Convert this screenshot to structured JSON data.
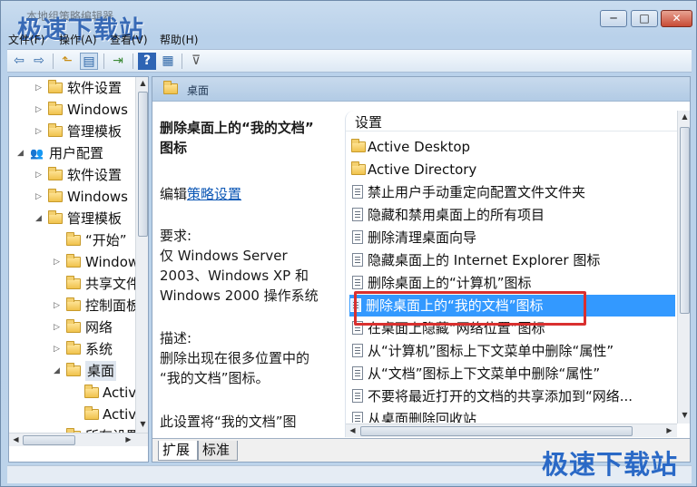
{
  "window": {
    "title": "本地组策略编辑器",
    "watermark_top": "极速下载站",
    "watermark_bottom": "极速下载站",
    "controls": {
      "minimize": "─",
      "maximize": "□",
      "close": "✕"
    }
  },
  "menu": [
    "文件(F)",
    "操作(A)",
    "查看(V)",
    "帮助(H)"
  ],
  "toolbar": {
    "icons": [
      "back-arrow-icon",
      "forward-arrow-icon",
      "up-folder-icon",
      "show-tree-icon",
      "export-list-icon",
      "help-icon",
      "properties-icon",
      "filter-icon"
    ],
    "glyphs": [
      "⇦",
      "⇨",
      "⬑",
      "▤",
      "⇥",
      "?",
      "▦",
      "⊽"
    ]
  },
  "tree": [
    {
      "label": "软件设置",
      "expander": "▷"
    },
    {
      "label": "Windows",
      "expander": "▷"
    },
    {
      "label": "管理模板",
      "expander": "▷"
    },
    {
      "label": "用户配置",
      "expander": "◢"
    },
    {
      "label": "软件设置",
      "expander": "▷"
    },
    {
      "label": "Windows",
      "expander": "▷"
    },
    {
      "label": "管理模板",
      "expander": "◢"
    },
    {
      "label": "“开始”",
      "expander": ""
    },
    {
      "label": "Window",
      "expander": "▷"
    },
    {
      "label": "共享文件",
      "expander": ""
    },
    {
      "label": "控制面板",
      "expander": "▷"
    },
    {
      "label": "网络",
      "expander": "▷"
    },
    {
      "label": "系统",
      "expander": "▷"
    },
    {
      "label": "桌面",
      "expander": "◢"
    },
    {
      "label": "Activ",
      "expander": ""
    },
    {
      "label": "Activ",
      "expander": ""
    },
    {
      "label": "所有设置",
      "expander": ""
    }
  ],
  "breadcrumb": "桌面",
  "description": {
    "title_line1": "删除桌面上的“我的文档”",
    "title_line2": "图标",
    "edit_prefix": "编辑",
    "edit_link": "策略设置",
    "req_label": "要求:",
    "req_line1": "仅 Windows Server",
    "req_line2": "2003、Windows XP 和",
    "req_line3": "Windows 2000 操作系统",
    "desc_label": "描述:",
    "desc_line1": "删除出现在很多位置中的",
    "desc_line2": "“我的文档”图标。",
    "desc_line3": "此设置将“我的文档”图"
  },
  "list": {
    "header": "设置",
    "rows": [
      {
        "type": "folder",
        "label": "Active Desktop"
      },
      {
        "type": "folder",
        "label": "Active Directory"
      },
      {
        "type": "policy",
        "label": "禁止用户手动重定向配置文件文件夹"
      },
      {
        "type": "policy",
        "label": "隐藏和禁用桌面上的所有项目"
      },
      {
        "type": "policy",
        "label": "删除清理桌面向导"
      },
      {
        "type": "policy",
        "label": "隐藏桌面上的 Internet Explorer 图标"
      },
      {
        "type": "policy",
        "label": "删除桌面上的“计算机”图标"
      },
      {
        "type": "policy",
        "label": "删除桌面上的“我的文档”图标",
        "selected": true
      },
      {
        "type": "policy",
        "label": "在桌面上隐藏“网络位置”图标"
      },
      {
        "type": "policy",
        "label": "从“计算机”图标上下文菜单中删除“属性”"
      },
      {
        "type": "policy",
        "label": "从“文档”图标上下文菜单中删除“属性”"
      },
      {
        "type": "policy",
        "label": "不要将最近打开的文档的共享添加到“网络..."
      },
      {
        "type": "policy",
        "label": "从桌面删除回收站"
      }
    ]
  },
  "tabs": [
    "扩展",
    "标准"
  ],
  "colors": {
    "selection": "#3399ff",
    "highlight_box": "#d9302f",
    "link": "#0c57b5"
  }
}
